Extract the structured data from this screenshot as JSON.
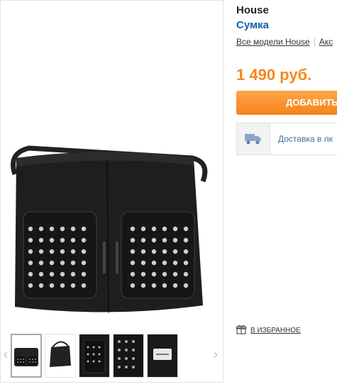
{
  "product": {
    "brand": "House",
    "type": "Сумка",
    "all_models_link": "Все модели House",
    "accessories_link": "Акс",
    "price": "1 490 руб.",
    "add_button": "ДОБАВИТЬ"
  },
  "delivery": {
    "text": "Доставка в лк",
    "icon": "truck-icon"
  },
  "favorite": {
    "label": "В ИЗБРАННОЕ",
    "icon": "gift-icon"
  },
  "gallery": {
    "prev_arrow": "‹",
    "next_arrow": "›",
    "thumbnail_count": 5,
    "selected_index": 0
  },
  "colors": {
    "price": "#f7861c",
    "button": "#f5831a",
    "link_blue": "#1b5fa8"
  }
}
